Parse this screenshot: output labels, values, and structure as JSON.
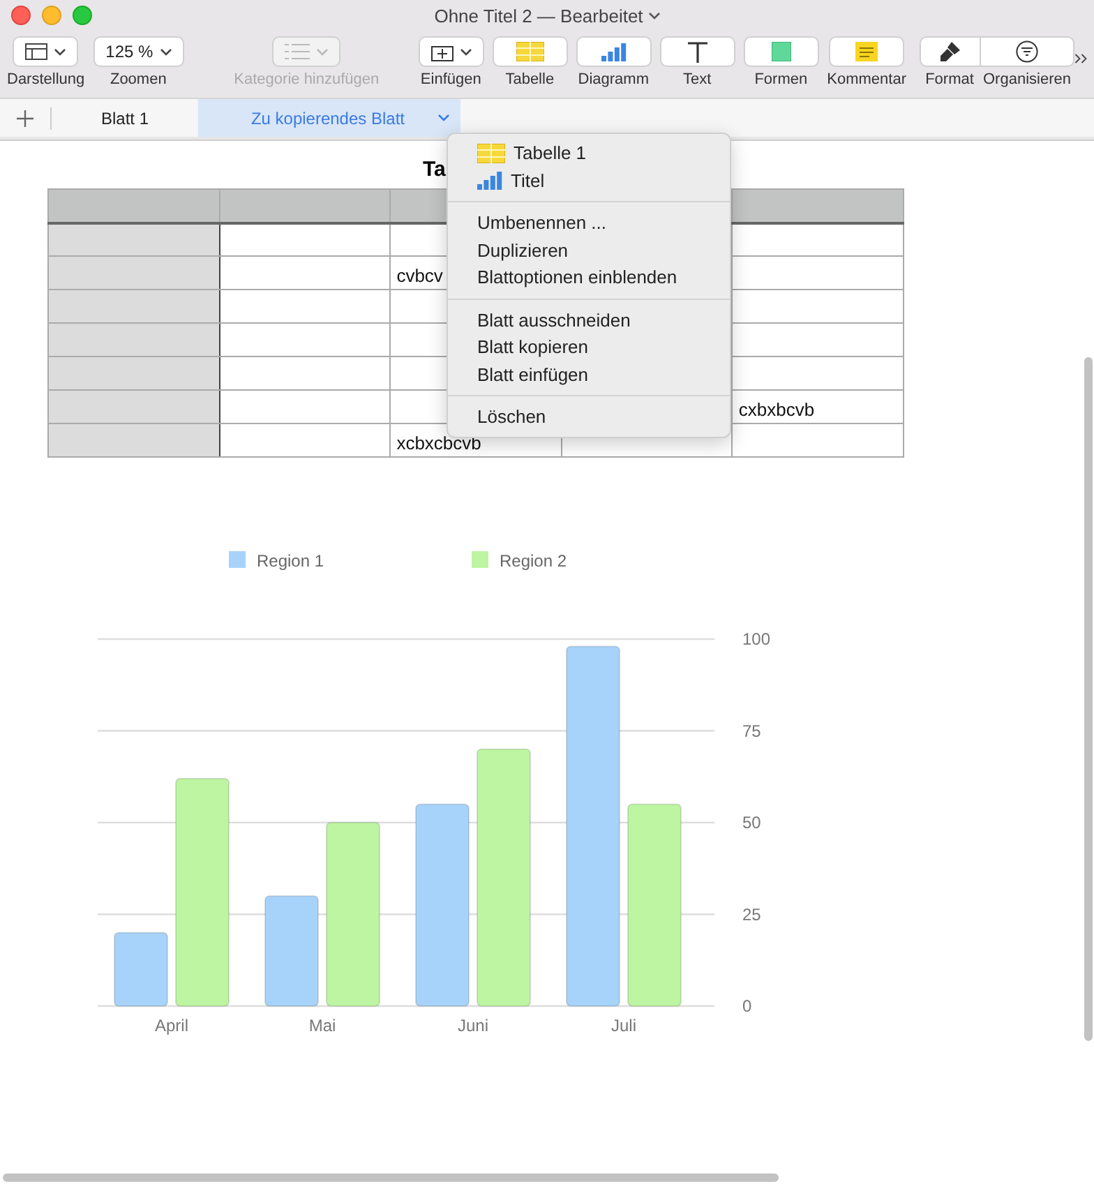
{
  "window": {
    "title": "Ohne Titel 2 — Bearbeitet"
  },
  "toolbar": [
    {
      "kind": "view",
      "label": "Darstellung",
      "disabled": false
    },
    {
      "kind": "zoom",
      "label": "Zoomen",
      "value": "125 %",
      "disabled": false
    },
    {
      "kind": "category",
      "label": "Kategorie hinzufügen",
      "disabled": true
    },
    {
      "kind": "insert",
      "label": "Einfügen",
      "disabled": false
    },
    {
      "kind": "table",
      "label": "Tabelle",
      "disabled": false
    },
    {
      "kind": "chart",
      "label": "Diagramm",
      "disabled": false
    },
    {
      "kind": "text",
      "label": "Text",
      "disabled": false
    },
    {
      "kind": "shape",
      "label": "Formen",
      "disabled": false
    },
    {
      "kind": "comment",
      "label": "Kommentar",
      "disabled": false
    },
    {
      "kind": "format",
      "label": "Format",
      "disabled": false
    },
    {
      "kind": "organize",
      "label": "Organisieren",
      "disabled": false
    }
  ],
  "tabs": [
    {
      "label": "Blatt 1",
      "selected": false
    },
    {
      "label": "Zu kopierendes Blatt",
      "selected": true
    }
  ],
  "table": {
    "title": "Ta",
    "rows": [
      [
        "",
        "",
        "",
        "",
        ""
      ],
      [
        "",
        "",
        "cvbcv",
        "",
        ""
      ],
      [
        "",
        "",
        "",
        "",
        ""
      ],
      [
        "",
        "",
        "",
        "",
        ""
      ],
      [
        "",
        "",
        "",
        "",
        ""
      ],
      [
        "",
        "",
        "",
        "",
        "cxbxbcvb"
      ],
      [
        "",
        "",
        "xcbxcbcvb",
        "",
        ""
      ]
    ]
  },
  "menu": [
    [
      {
        "kind": "table",
        "label": "Tabelle 1"
      },
      {
        "kind": "chart",
        "label": "Titel"
      }
    ],
    [
      {
        "kind": "command",
        "label": "Umbenennen ..."
      },
      {
        "kind": "command",
        "label": "Duplizieren"
      },
      {
        "kind": "command",
        "label": "Blattoptionen einblenden"
      }
    ],
    [
      {
        "kind": "command",
        "label": "Blatt ausschneiden"
      },
      {
        "kind": "command",
        "label": "Blatt kopieren"
      },
      {
        "kind": "command",
        "label": "Blatt einfügen"
      }
    ],
    [
      {
        "kind": "command",
        "label": "Löschen"
      }
    ]
  ],
  "chart_data": {
    "type": "bar",
    "categories": [
      "April",
      "Mai",
      "Juni",
      "Juli"
    ],
    "series": [
      {
        "name": "Region 1",
        "color": "#a7d3fb",
        "values": [
          20,
          30,
          55,
          98
        ]
      },
      {
        "name": "Region 2",
        "color": "#bdf5a2",
        "values": [
          62,
          50,
          70,
          55
        ]
      }
    ],
    "ylim": [
      0,
      100
    ],
    "yticks": [
      0,
      25,
      50,
      75,
      100
    ],
    "grid": true,
    "legend": true
  }
}
